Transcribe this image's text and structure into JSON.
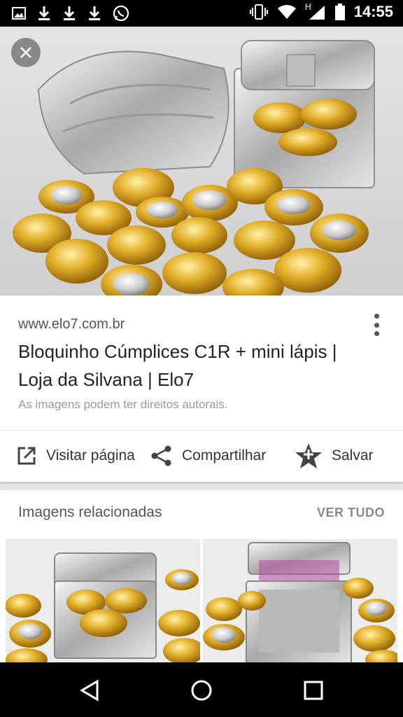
{
  "status_bar": {
    "time": "14:55",
    "network": "H",
    "icons": [
      "image-icon",
      "download-icon",
      "download-icon",
      "download-icon",
      "whatsapp-icon",
      "vibrate-icon",
      "wifi-icon",
      "signal-icon",
      "battery-icon"
    ]
  },
  "viewer": {
    "close_icon": "close-icon"
  },
  "result": {
    "source": "www.elo7.com.br",
    "title": "Bloquinho Cúmplices C1R + mini lápis | Loja da Silvana | Elo7",
    "copyright_note": "As imagens podem ter direitos autorais.",
    "more_icon": "more-vert-icon"
  },
  "actions": {
    "visit_label": "Visitar página",
    "share_label": "Compartilhar",
    "save_label": "Salvar"
  },
  "related": {
    "title": "Imagens relacionadas",
    "see_all_label": "VER TUDO"
  },
  "nav_bar": {
    "icons": [
      "back-icon",
      "home-icon",
      "recents-icon"
    ]
  },
  "colors": {
    "gold": "#d9a520",
    "silver": "#d8d8d8",
    "text_primary": "#222222",
    "text_secondary": "#555555"
  }
}
